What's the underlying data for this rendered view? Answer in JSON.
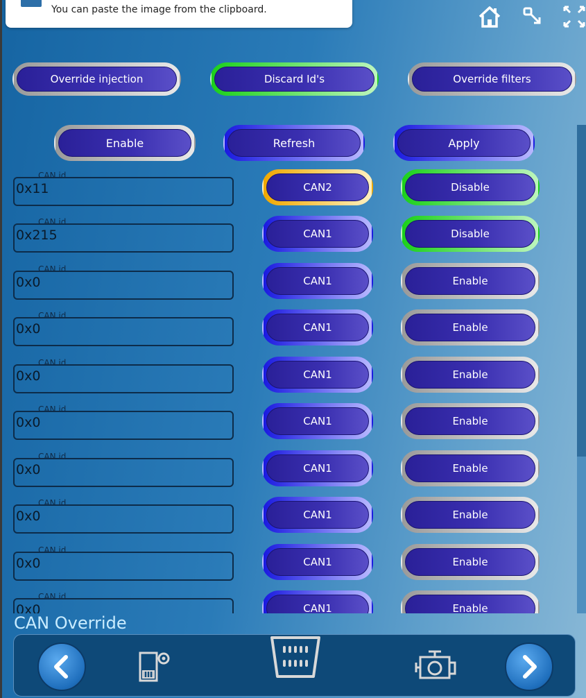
{
  "toast": {
    "message": "You can paste the image from the clipboard."
  },
  "top_icons": [
    "home-icon",
    "restore-icon",
    "fullscreen-icon"
  ],
  "actions_row1": [
    {
      "label": "Override injection",
      "ring": "gray"
    },
    {
      "label": "Discard Id's",
      "ring": "green"
    },
    {
      "label": "Override filters",
      "ring": "gray"
    }
  ],
  "actions_row2": [
    {
      "label": "Enable",
      "ring": "gray"
    },
    {
      "label": "Refresh",
      "ring": "blue"
    },
    {
      "label": "Apply",
      "ring": "blue"
    }
  ],
  "field_label": "CAN id",
  "rows": [
    {
      "can_id": "0x11",
      "bus": "CAN2",
      "bus_ring": "yellow",
      "state": "Disable",
      "state_ring": "green"
    },
    {
      "can_id": "0x215",
      "bus": "CAN1",
      "bus_ring": "blue",
      "state": "Disable",
      "state_ring": "green"
    },
    {
      "can_id": "0x0",
      "bus": "CAN1",
      "bus_ring": "blue",
      "state": "Enable",
      "state_ring": "gray"
    },
    {
      "can_id": "0x0",
      "bus": "CAN1",
      "bus_ring": "blue",
      "state": "Enable",
      "state_ring": "gray"
    },
    {
      "can_id": "0x0",
      "bus": "CAN1",
      "bus_ring": "blue",
      "state": "Enable",
      "state_ring": "gray"
    },
    {
      "can_id": "0x0",
      "bus": "CAN1",
      "bus_ring": "blue",
      "state": "Enable",
      "state_ring": "gray"
    },
    {
      "can_id": "0x0",
      "bus": "CAN1",
      "bus_ring": "blue",
      "state": "Enable",
      "state_ring": "gray"
    },
    {
      "can_id": "0x0",
      "bus": "CAN1",
      "bus_ring": "blue",
      "state": "Enable",
      "state_ring": "gray"
    },
    {
      "can_id": "0x0",
      "bus": "CAN1",
      "bus_ring": "blue",
      "state": "Enable",
      "state_ring": "gray"
    },
    {
      "can_id": "0x0",
      "bus": "CAN1",
      "bus_ring": "blue",
      "state": "Enable",
      "state_ring": "gray"
    }
  ],
  "page_title": "CAN Override",
  "bottom_nav": [
    "back-icon",
    "sd-card-settings-icon",
    "obd-connector-icon",
    "engine-icon",
    "forward-icon"
  ]
}
